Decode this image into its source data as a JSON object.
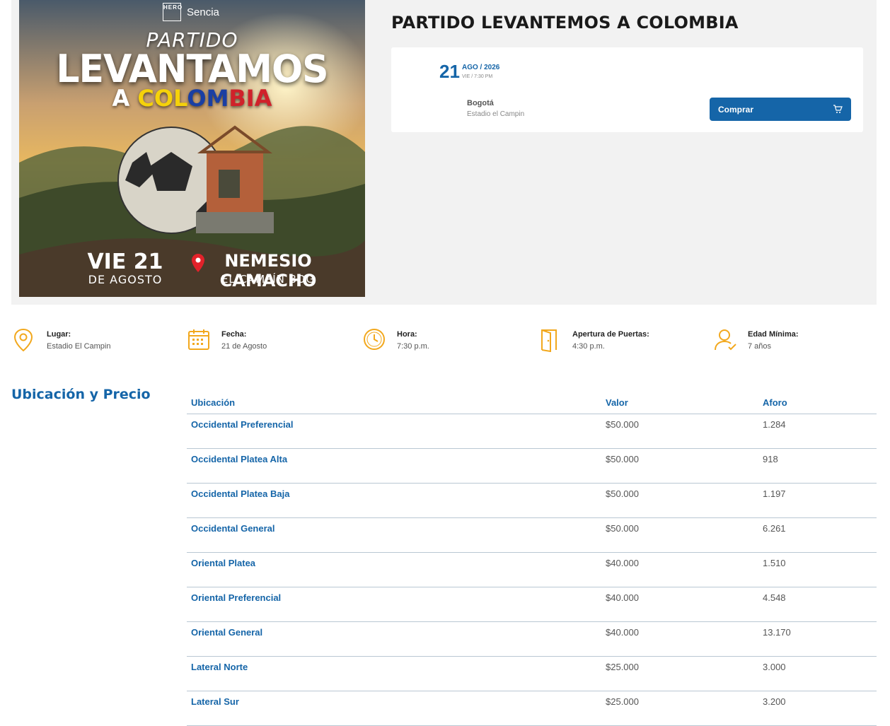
{
  "poster": {
    "brand_logo_text": "HERO",
    "brand_name": "Sencia",
    "line1": "PARTIDO",
    "line2": "LEVANTAMOS",
    "line3_a": "A ",
    "line3_col_y": "COL",
    "line3_col_b": "OM",
    "line3_col_r": "BIA",
    "date_big": "VIE 21",
    "date_small": "DE AGOSTO",
    "venue_big": "NEMESIO CAMACHO",
    "venue_small": "EL CAMPÍN BOG"
  },
  "event": {
    "title": "PARTIDO LEVANTEMOS A COLOMBIA",
    "day": "21",
    "month_year": "AGO / 2026",
    "weekday_time": "VIE / 7:30 PM",
    "city": "Bogotá",
    "venue": "Estadio el Campin",
    "buy_label": "Comprar"
  },
  "info": [
    {
      "icon": "location-pin-icon",
      "label": "Lugar:",
      "value": "Estadio El Campin"
    },
    {
      "icon": "calendar-icon",
      "label": "Fecha:",
      "value": "21 de Agosto"
    },
    {
      "icon": "clock-icon",
      "label": "Hora:",
      "value": "7:30 p.m."
    },
    {
      "icon": "door-icon",
      "label": "Apertura de Puertas:",
      "value": "4:30 p.m."
    },
    {
      "icon": "user-check-icon",
      "label": "Edad Mínima:",
      "value": "7 años"
    }
  ],
  "prices": {
    "section_title": "Ubicación y Precio",
    "headers": [
      "Ubicación",
      "Valor",
      "Aforo"
    ],
    "rows": [
      [
        "Occidental Preferencial",
        "$50.000",
        "1.284"
      ],
      [
        "Occidental Platea Alta",
        "$50.000",
        "918"
      ],
      [
        "Occidental Platea Baja",
        "$50.000",
        "1.197"
      ],
      [
        "Occidental General",
        "$50.000",
        "6.261"
      ],
      [
        "Oriental Platea",
        "$40.000",
        "1.510"
      ],
      [
        "Oriental Preferencial",
        "$40.000",
        "4.548"
      ],
      [
        "Oriental General",
        "$40.000",
        "13.170"
      ],
      [
        "Lateral Norte",
        "$25.000",
        "3.000"
      ],
      [
        "Lateral Sur",
        "$25.000",
        "3.200"
      ]
    ]
  },
  "colors": {
    "accent": "#1565a8",
    "icon": "#f2a81d",
    "band": "#f2f2f2"
  }
}
